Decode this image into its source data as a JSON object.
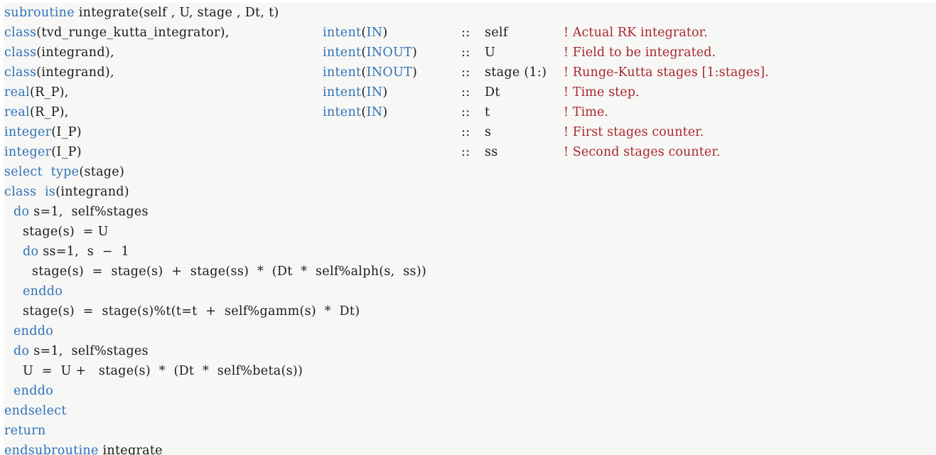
{
  "colors": {
    "background": "#ffffff",
    "panel": "#f7f7f5",
    "keyword": "#2f72b8",
    "identifier": "#1a1a1a",
    "comment": "#a8282f"
  },
  "code": {
    "language": "Fortran",
    "routine_name": "integrate",
    "lines": [
      {
        "n": 1,
        "indent": 0,
        "text": "subroutine integrate(self, U, stage, Dt, t)",
        "keyword": "subroutine",
        "rest": " integrate(self , U, stage , Dt, t)",
        "comment": ""
      },
      {
        "n": 2,
        "indent": 0,
        "text": "class(tvd_runge_kutta_integrator), intent(IN) :: self",
        "type_kw": "class",
        "type_rest": "(tvd_runge_kutta_integrator),",
        "intent_kw": "intent",
        "intent_open": "(",
        "intent_val": "IN",
        "intent_close": ")",
        "sep": "::",
        "var": "self",
        "comment": "! Actual RK integrator."
      },
      {
        "n": 3,
        "indent": 0,
        "text": "class(integrand), intent(INOUT) :: U",
        "type_kw": "class",
        "type_rest": "(integrand),",
        "intent_kw": "intent",
        "intent_open": "(",
        "intent_val": "INOUT",
        "intent_close": ")",
        "sep": "::",
        "var": "U",
        "comment": "! Field to be integrated."
      },
      {
        "n": 4,
        "indent": 0,
        "text": "class(integrand), intent(INOUT) :: stage(1:)",
        "type_kw": "class",
        "type_rest": "(integrand),",
        "intent_kw": "intent",
        "intent_open": "(",
        "intent_val": "INOUT",
        "intent_close": ")",
        "sep": "::",
        "var": "stage (1:)",
        "comment": "! Runge-Kutta stages [1:stages]."
      },
      {
        "n": 5,
        "indent": 0,
        "text": "real(R_P), intent(IN) :: Dt",
        "type_kw": "real",
        "type_rest": "(R_P),",
        "intent_kw": "intent",
        "intent_open": "(",
        "intent_val": "IN",
        "intent_close": ")",
        "sep": "::",
        "var": "Dt",
        "comment": "! Time step."
      },
      {
        "n": 6,
        "indent": 0,
        "text": "real(R_P), intent(IN) :: t",
        "type_kw": "real",
        "type_rest": "(R_P),",
        "intent_kw": "intent",
        "intent_open": "(",
        "intent_val": "IN",
        "intent_close": ")",
        "sep": "::",
        "var": "t",
        "comment": "! Time."
      },
      {
        "n": 7,
        "indent": 0,
        "text": "integer(I_P) :: s",
        "type_kw": "integer",
        "type_rest": "(I_P)",
        "intent_kw": "",
        "intent_open": "",
        "intent_val": "",
        "intent_close": "",
        "sep": "::",
        "var": "s",
        "comment": "! First stages counter."
      },
      {
        "n": 8,
        "indent": 0,
        "text": "integer(I_P) :: ss",
        "type_kw": "integer",
        "type_rest": "(I_P)",
        "intent_kw": "",
        "intent_open": "",
        "intent_val": "",
        "intent_close": "",
        "sep": "::",
        "var": "ss",
        "comment": "! Second stages counter."
      },
      {
        "n": 9,
        "indent": 0,
        "keyword": "select  type",
        "rest": "(stage)",
        "comment": ""
      },
      {
        "n": 10,
        "indent": 0,
        "keyword": "class  is",
        "rest": "(integrand)",
        "comment": ""
      },
      {
        "n": 11,
        "indent": 1,
        "keyword": "do",
        "rest": " s=1,  self%stages",
        "comment": ""
      },
      {
        "n": 12,
        "indent": 2,
        "keyword": "",
        "rest": "stage(s)  = U",
        "comment": ""
      },
      {
        "n": 13,
        "indent": 2,
        "keyword": "do",
        "rest": " ss=1,  s  −  1",
        "comment": ""
      },
      {
        "n": 14,
        "indent": 3,
        "keyword": "",
        "rest": "stage(s)  =  stage(s)  +  stage(ss)  *  (Dt  *  self%alph(s,  ss))",
        "comment": ""
      },
      {
        "n": 15,
        "indent": 2,
        "keyword": "enddo",
        "rest": "",
        "comment": ""
      },
      {
        "n": 16,
        "indent": 2,
        "keyword": "",
        "rest": "stage(s)  =  stage(s)%t(t=t  +  self%gamm(s)  *  Dt)",
        "comment": ""
      },
      {
        "n": 17,
        "indent": 1,
        "keyword": "enddo",
        "rest": "",
        "comment": ""
      },
      {
        "n": 18,
        "indent": 1,
        "keyword": "do",
        "rest": " s=1,  self%stages",
        "comment": ""
      },
      {
        "n": 19,
        "indent": 2,
        "keyword": "",
        "rest": "U  =  U +   stage(s)  *  (Dt  *  self%beta(s))",
        "comment": ""
      },
      {
        "n": 20,
        "indent": 1,
        "keyword": "enddo",
        "rest": "",
        "comment": ""
      },
      {
        "n": 21,
        "indent": 0,
        "keyword": "endselect",
        "rest": "",
        "comment": ""
      },
      {
        "n": 22,
        "indent": 0,
        "keyword": "return",
        "rest": "",
        "comment": ""
      },
      {
        "n": 23,
        "indent": 0,
        "keyword": "endsubroutine",
        "rest": " integrate",
        "comment": ""
      }
    ]
  }
}
